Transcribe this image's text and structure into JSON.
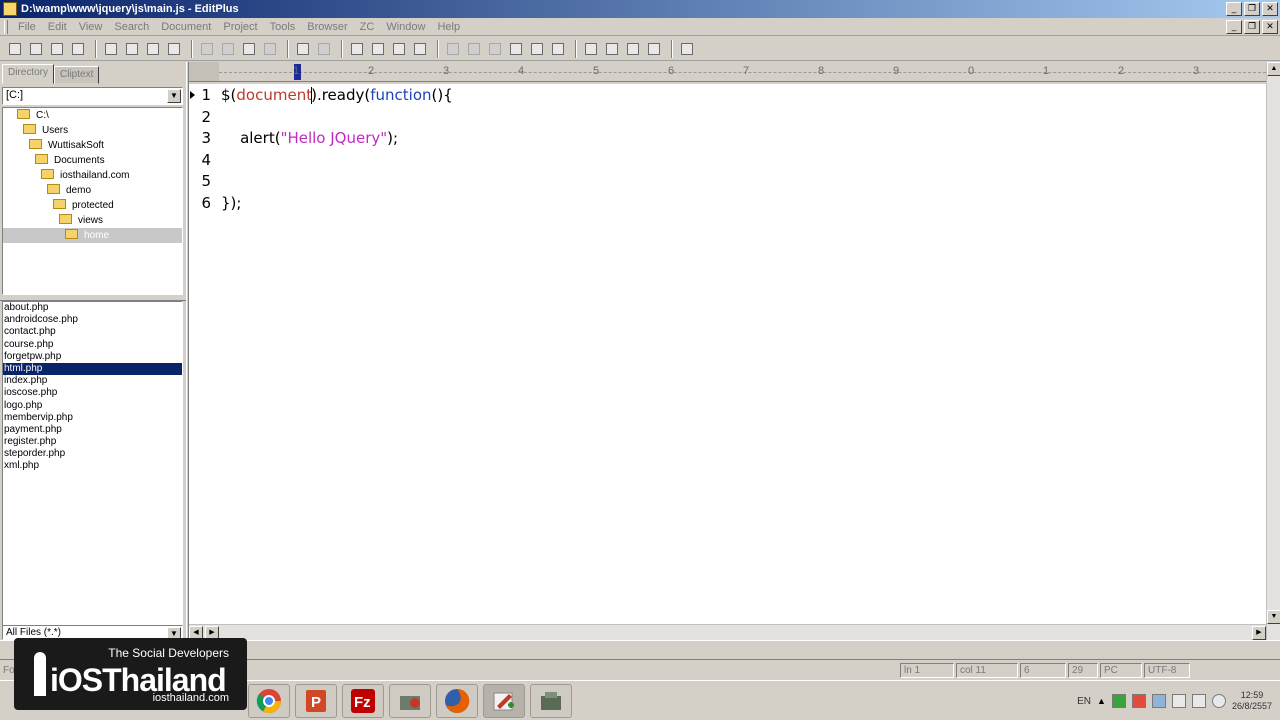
{
  "window": {
    "title": "D:\\wamp\\www\\jquery\\js\\main.js - EditPlus"
  },
  "menu": [
    "File",
    "Edit",
    "View",
    "Search",
    "Document",
    "Project",
    "Tools",
    "Browser",
    "ZC",
    "Window",
    "Help"
  ],
  "sidebar": {
    "tabs": [
      "Directory",
      "Cliptext"
    ],
    "drive": "[C:]",
    "tree": [
      {
        "label": "C:\\",
        "indent": 0
      },
      {
        "label": "Users",
        "indent": 1
      },
      {
        "label": "WuttisakSoft",
        "indent": 2
      },
      {
        "label": "Documents",
        "indent": 3
      },
      {
        "label": "iosthailand.com",
        "indent": 4
      },
      {
        "label": "demo",
        "indent": 5
      },
      {
        "label": "protected",
        "indent": 6
      },
      {
        "label": "views",
        "indent": 7
      },
      {
        "label": "home",
        "indent": 8,
        "selected": true
      }
    ],
    "files": [
      "about.php",
      "androidcose.php",
      "contact.php",
      "course.php",
      "forgetpw.php",
      "html.php",
      "index.php",
      "ioscose.php",
      "logo.php",
      "membervip.php",
      "payment.php",
      "register.php",
      "steporder.php",
      "xml.php"
    ],
    "selected_file": "html.php",
    "filter": "All Files (*.*)"
  },
  "ruler": {
    "ticks": [
      "1",
      "2",
      "3",
      "4",
      "5",
      "6",
      "7",
      "8",
      "9",
      "0",
      "1",
      "2",
      "3"
    ]
  },
  "editor": {
    "line_numbers": [
      "1",
      "2",
      "3",
      "4",
      "5",
      "6"
    ],
    "lines": [
      [
        {
          "t": "$(",
          "c": ""
        },
        {
          "t": "document",
          "c": "red"
        },
        {
          "t": "CARET",
          "c": "caret"
        },
        {
          "t": ").ready(",
          "c": ""
        },
        {
          "t": "function",
          "c": "blue"
        },
        {
          "t": "(){",
          "c": ""
        }
      ],
      [],
      [
        {
          "t": "    alert(",
          "c": ""
        },
        {
          "t": "\"Hello JQuery\"",
          "c": "mag"
        },
        {
          "t": ");",
          "c": ""
        }
      ],
      [],
      [],
      [
        {
          "t": "});",
          "c": ""
        }
      ]
    ]
  },
  "status": {
    "help": "For Help, press F1",
    "cells": [
      "ln 1",
      "col 11",
      "6",
      "29",
      "PC",
      "UTF-8"
    ]
  },
  "taskbar": {
    "apps": [
      "chrome-app",
      "powerpoint-app",
      "filezilla-app",
      "tool-app",
      "firefox-app",
      "editplus-app",
      "misc-app"
    ],
    "lang": "EN",
    "time": "12:59",
    "date": "26/8/2557"
  },
  "watermark": {
    "tagline": "The Social Developers",
    "brand": "iOSThailand",
    "url": "iosthailand.com"
  }
}
